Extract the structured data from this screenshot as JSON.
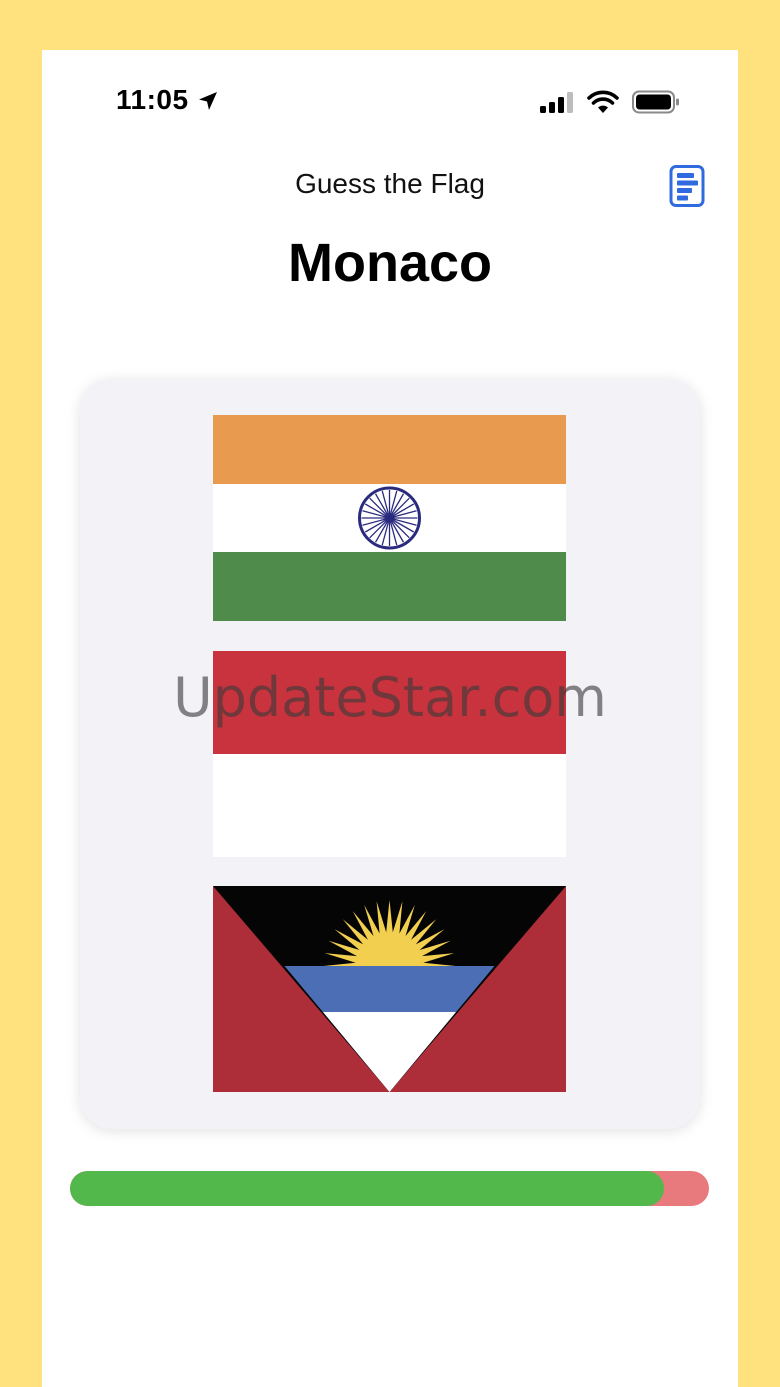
{
  "status_bar": {
    "time": "11:05",
    "icons": [
      "location-arrow-icon",
      "cellular-signal-icon",
      "wifi-icon",
      "battery-icon"
    ]
  },
  "nav": {
    "title": "Guess the Flag",
    "score_icon": "score-list-icon"
  },
  "question": {
    "country": "Monaco"
  },
  "flags": [
    {
      "id": "india",
      "colors": [
        "#E89A4F",
        "#FFFFFF",
        "#4F8B4A"
      ],
      "emblem_color": "#2A2A7E"
    },
    {
      "id": "indonesia-or-monaco",
      "colors": [
        "#C9333D",
        "#FFFFFF"
      ]
    },
    {
      "id": "antigua-and-barbuda",
      "colors": [
        "#AD2E38",
        "#050505",
        "#F2CF4F",
        "#4C6EB5",
        "#FFFFFF"
      ]
    }
  ],
  "watermark": "UpdateStar.com",
  "progress": {
    "fraction": 0.93,
    "colors": {
      "correct": "#52B84B",
      "wrong": "#E87A7D"
    }
  },
  "colors": {
    "background": "#FFE17E",
    "card": "#F2F2F7",
    "accent": "#2F6BDF"
  }
}
